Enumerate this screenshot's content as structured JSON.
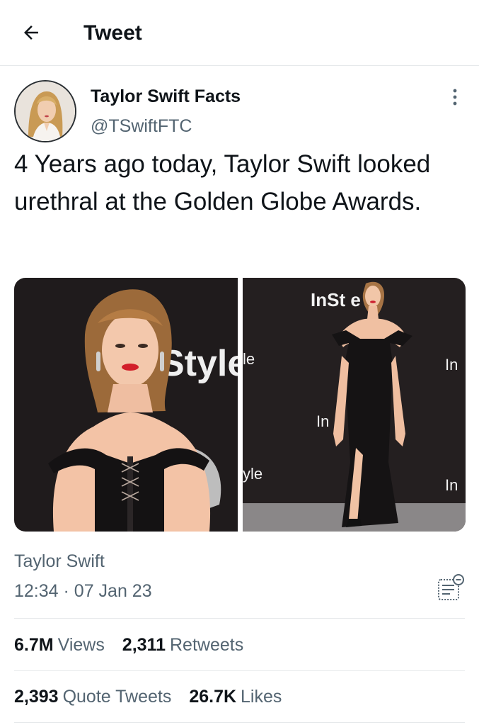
{
  "header": {
    "title": "Tweet",
    "back_icon": "arrow-left-icon"
  },
  "author": {
    "name": "Taylor Swift Facts",
    "handle": "@TSwiftFTC",
    "more_icon": "more-vertical-icon"
  },
  "tweet": {
    "text": "4 Years ago today, Taylor Swift looked urethral at the Golden Globe Awards.",
    "media": [
      {
        "backdrop_text": "Style",
        "backdrop_text_2": "le",
        "backdrop_text_3": "yle"
      },
      {
        "backdrop_text": "InSt e",
        "backdrop_text_2": "In",
        "backdrop_text_3": "In",
        "backdrop_text_4": "In"
      }
    ],
    "tagged": "Taylor Swift",
    "time": "12:34",
    "date": "07 Jan 23",
    "analytics_icon": "view-analytics-icon"
  },
  "stats": {
    "views": {
      "value": "6.7M",
      "label": "Views"
    },
    "retweets": {
      "value": "2,311",
      "label": "Retweets"
    },
    "quotes": {
      "value": "2,393",
      "label": "Quote Tweets"
    },
    "likes": {
      "value": "26.7K",
      "label": "Likes"
    }
  },
  "colors": {
    "text": "#0f1419",
    "secondary": "#536471",
    "divider": "#e6e9eb"
  }
}
